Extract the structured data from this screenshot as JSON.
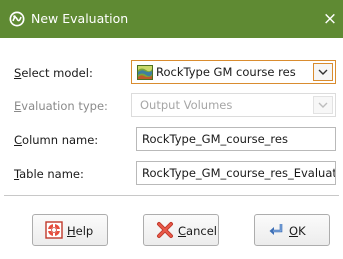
{
  "dialog": {
    "title": "New Evaluation",
    "close_glyph": "×"
  },
  "form": {
    "select_model": {
      "label_mnemonic": "S",
      "label_rest": "elect model:",
      "value": "RockType GM course res",
      "icon": "geological-model-icon"
    },
    "evaluation_type": {
      "label_mnemonic": "E",
      "label_rest": "valuation type:",
      "value": "Output Volumes",
      "disabled": true
    },
    "column_name": {
      "label_mnemonic": "C",
      "label_rest": "olumn name:",
      "value": "RockType_GM_course_res"
    },
    "table_name": {
      "label_mnemonic": "T",
      "label_rest": "able name:",
      "value": "RockType_GM_course_res_Evaluat"
    }
  },
  "buttons": {
    "help": {
      "mnemonic": "H",
      "rest": "elp",
      "icon": "lifebuoy-icon"
    },
    "cancel": {
      "mnemonic": "C",
      "rest": "ancel",
      "icon": "red-x-icon"
    },
    "ok": {
      "mnemonic": "O",
      "rest": "K",
      "icon": "enter-arrow-icon"
    }
  },
  "colors": {
    "titlebar": "#5f8a33",
    "focus_border": "#d98c2f"
  }
}
